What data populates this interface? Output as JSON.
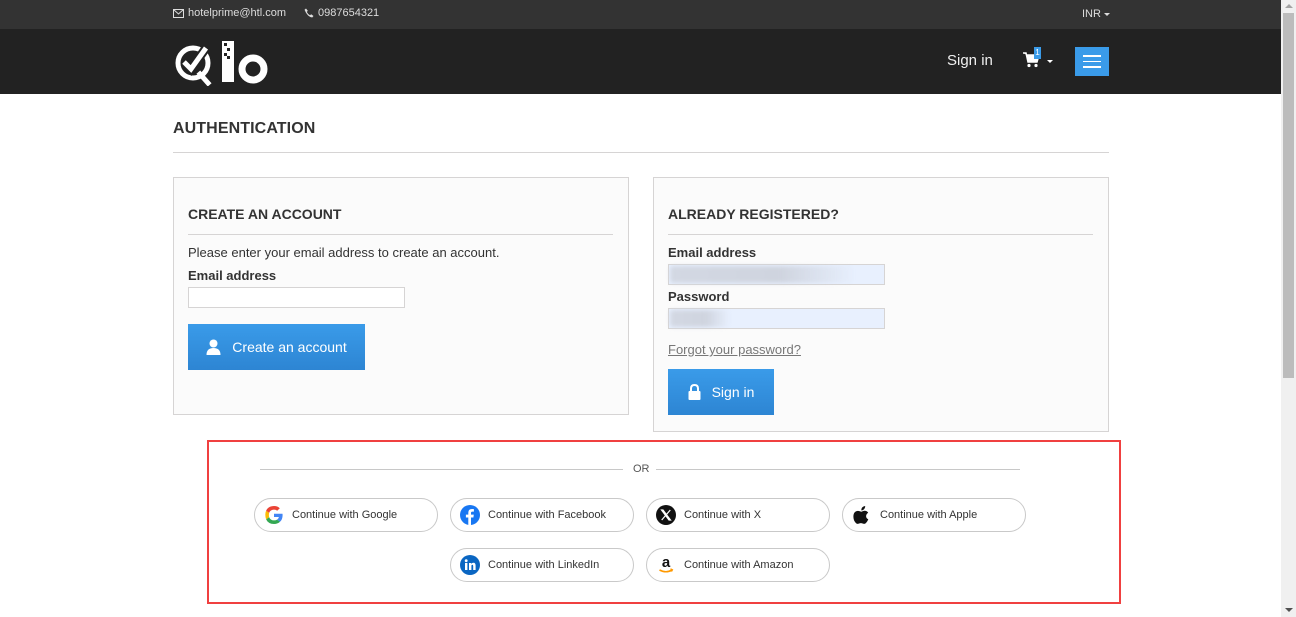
{
  "topbar": {
    "email": "hotelprime@htl.com",
    "phone": "0987654321",
    "currency": "INR"
  },
  "header": {
    "logo_alt": "Qlo",
    "signin_label": "Sign in",
    "cart_count": "1",
    "menu_icon": "hamburger-icon"
  },
  "page": {
    "title": "AUTHENTICATION"
  },
  "create_account": {
    "heading": "CREATE AN ACCOUNT",
    "description": "Please enter your email address to create an account.",
    "email_label": "Email address",
    "email_value": "",
    "email_placeholder": "",
    "button_label": "Create an account",
    "button_icon": "user-icon"
  },
  "login": {
    "heading": "ALREADY REGISTERED?",
    "email_label": "Email address",
    "email_value": "",
    "password_label": "Password",
    "password_value": "",
    "forgot_label": "Forgot your password?",
    "button_label": "Sign in",
    "button_icon": "lock-icon"
  },
  "social": {
    "divider_text": "OR",
    "buttons": [
      {
        "label": "Continue with Google",
        "icon": "google-icon"
      },
      {
        "label": "Continue with Facebook",
        "icon": "facebook-icon"
      },
      {
        "label": "Continue with X",
        "icon": "x-icon"
      },
      {
        "label": "Continue with Apple",
        "icon": "apple-icon"
      },
      {
        "label": "Continue with LinkedIn",
        "icon": "linkedin-icon"
      },
      {
        "label": "Continue with Amazon",
        "icon": "amazon-icon"
      }
    ]
  },
  "colors": {
    "accent": "#3a9be9",
    "header_bg": "#222222",
    "topbar_bg": "#333333",
    "highlight_border": "#f04040"
  }
}
